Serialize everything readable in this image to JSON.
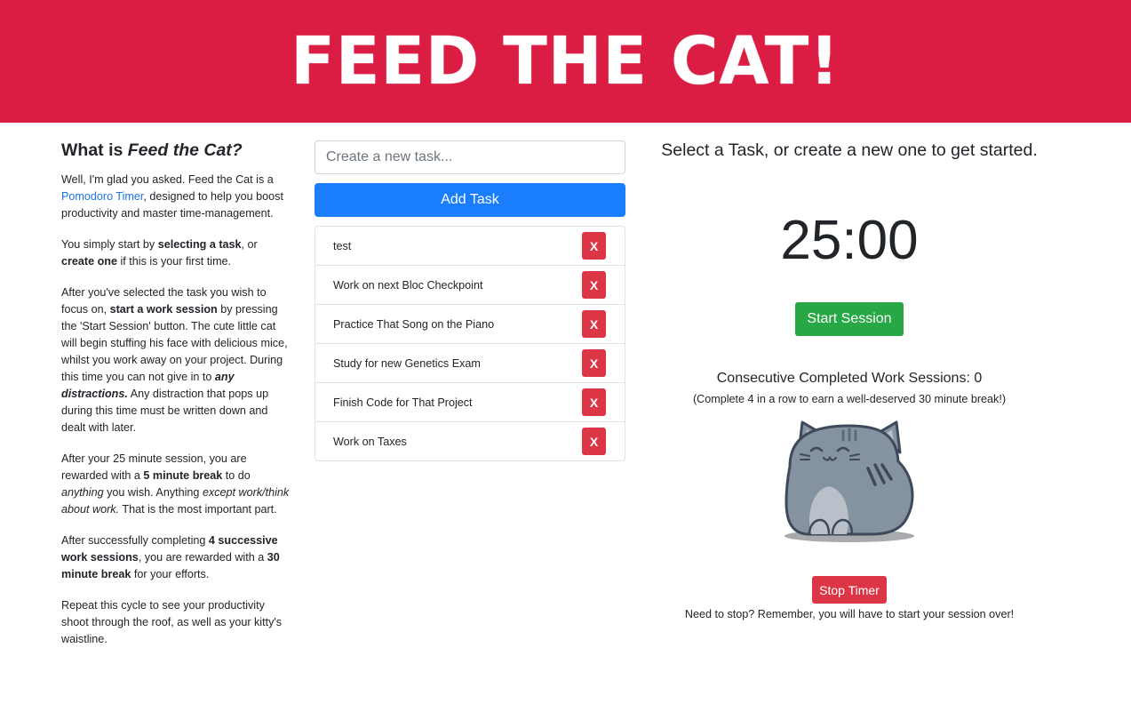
{
  "header": {
    "title": "FEED THE CAT!"
  },
  "about": {
    "heading_prefix": "What is ",
    "heading_em": "Feed the Cat?",
    "p1_pre": "Well, I'm glad you asked. Feed the Cat is a ",
    "p1_link": "Pomodoro Timer",
    "p1_post": ", designed to help you boost productivity and master time-management.",
    "p2_pre": "You simply start by ",
    "p2_b1": "selecting a task",
    "p2_mid": ", or ",
    "p2_b2": "create one",
    "p2_post": " if this is your first time.",
    "p3_pre": "After you've selected the task you wish to focus on, ",
    "p3_b1": "start a work session",
    "p3_mid": " by pressing the 'Start Session' button. The cute little cat will begin stuffing his face with delicious mice, whilst you work away on your project. During this time you can not give in to ",
    "p3_em": "any distractions.",
    "p3_post": " Any distraction that pops up during this time must be written down and dealt with later.",
    "p4_pre": "After your 25 minute session, you are rewarded with a ",
    "p4_b1": "5 minute break",
    "p4_mid1": " to do ",
    "p4_i1": "anything",
    "p4_mid2": " you wish. Anything ",
    "p4_i2": "except work/think about work.",
    "p4_post": " That is the most important part.",
    "p5_pre": "After successfully completing ",
    "p5_b1": "4 successive work sessions",
    "p5_mid": ", you are rewarded with a ",
    "p5_b2": "30 minute break",
    "p5_post": " for your efforts.",
    "p6": "Repeat this cycle to see your productivity shoot through the roof, as well as your kitty's waistline."
  },
  "tasks": {
    "input_placeholder": "Create a new task...",
    "input_value": "",
    "add_label": "Add Task",
    "delete_label": "X",
    "items": [
      {
        "name": "test"
      },
      {
        "name": "Work on next Bloc Checkpoint"
      },
      {
        "name": "Practice That Song on the Piano"
      },
      {
        "name": "Study for new Genetics Exam"
      },
      {
        "name": "Finish Code for That Project"
      },
      {
        "name": "Work on Taxes"
      }
    ]
  },
  "timer": {
    "prompt": "Select a Task, or create a new one to get started.",
    "display": "25:00",
    "start_label": "Start Session",
    "consecutive_label": "Consecutive Completed Work Sessions: ",
    "consecutive_count": "0",
    "break_note": "(Complete 4 in a row to earn a well-deserved 30 minute break!)",
    "stop_label": "Stop Timer",
    "stop_note": "Need to stop? Remember, you will have to start your session over!"
  },
  "colors": {
    "brand": "#db1d44",
    "primary": "#1a7efc",
    "success": "#28a745",
    "danger": "#dc3545",
    "cat_body": "#8592a0",
    "cat_outline": "#3e4a59"
  }
}
